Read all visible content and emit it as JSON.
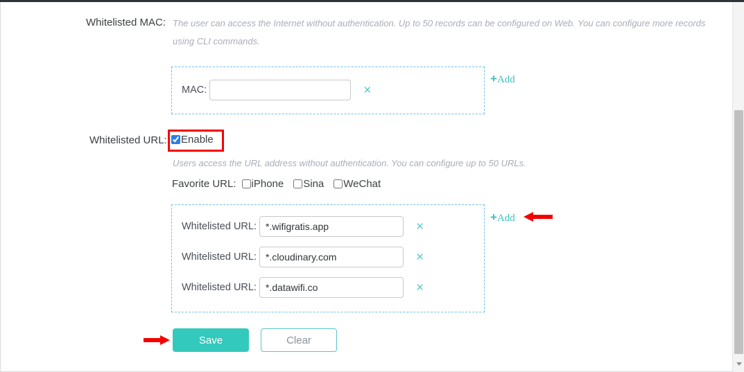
{
  "page": {
    "mac_section": {
      "label": "Whitelisted MAC:",
      "hint": "The user can access the Internet without authentication. Up to 50 records can be configured on Web. You can configure more records using CLI commands.",
      "entry_label": "MAC:",
      "entry_value": "",
      "entry_placeholder": "",
      "remove_icon": "close-icon",
      "remove_glyph": "×",
      "add_label": "Add",
      "add_plus": "+"
    },
    "url_section": {
      "label": "Whitelisted URL:",
      "enable_label": "Enable",
      "enable_checked": true,
      "hint": "Users access the URL address without authentication. You can configure up to 50 URLs.",
      "favorite_label": "Favorite URL:",
      "favorites": [
        {
          "label": "iPhone",
          "checked": false
        },
        {
          "label": "Sina",
          "checked": false
        },
        {
          "label": "WeChat",
          "checked": false
        }
      ],
      "entries": [
        {
          "label": "Whitelisted URL:",
          "value": "*.wifigratis.app",
          "remove_glyph": "×"
        },
        {
          "label": "Whitelisted URL:",
          "value": "*.cloudinary.com",
          "remove_glyph": "×"
        },
        {
          "label": "Whitelisted URL:",
          "value": "*.datawifi.co",
          "remove_glyph": "×"
        }
      ],
      "add_label": "Add",
      "add_plus": "+"
    },
    "actions": {
      "save_label": "Save",
      "clear_label": "Clear"
    },
    "colors": {
      "accent_teal": "#33c9bd",
      "dashed_blue": "#6fc0e8",
      "annotation_red": "#f40000",
      "checkbox_blue": "#2b7de9",
      "hint_gray": "#a9adb8"
    }
  }
}
